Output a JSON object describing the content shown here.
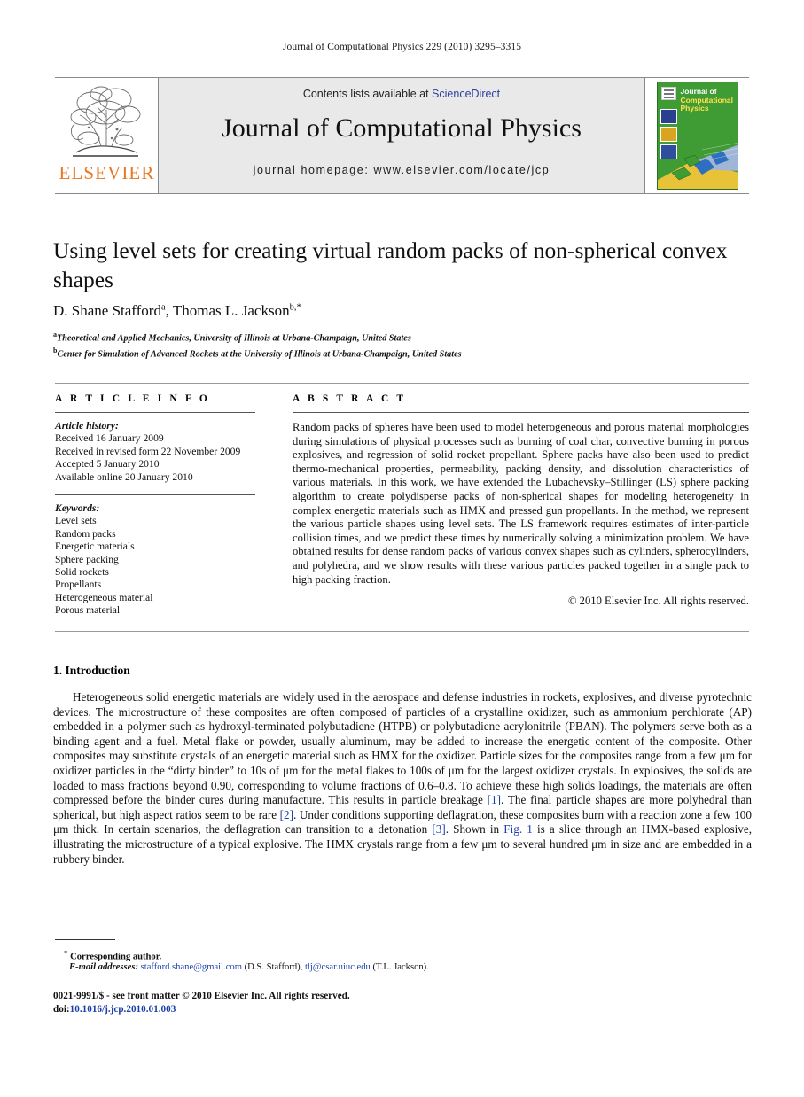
{
  "running_head": "Journal of Computational Physics 229 (2010) 3295–3315",
  "masthead": {
    "publisher_name": "ELSEVIER",
    "contents_prefix": "Contents lists available at",
    "sciencedirect_link": "ScienceDirect",
    "journal_name": "Journal of Computational Physics",
    "homepage_line": "journal homepage: www.elsevier.com/locate/jcp",
    "cover_title_line1": "Journal of",
    "cover_title_line2": "Computational",
    "cover_title_line3": "Physics",
    "accent_green": "#3f9c35",
    "accent_orange": "#e87722",
    "link_blue": "#2b3f9e"
  },
  "article": {
    "title": "Using level sets for creating virtual random packs of non-spherical convex shapes",
    "authors": "D. Shane Stafford ᵃ, Thomas L. Jackson ᵇ,*",
    "author_1": "D. Shane Stafford",
    "author_1_sup": "a",
    "author_2": "Thomas L. Jackson",
    "author_2_sup": "b,*",
    "affiliation_a_sup": "a",
    "affiliation_a": "Theoretical and Applied Mechanics, University of Illinois at Urbana-Champaign, United States",
    "affiliation_b_sup": "b",
    "affiliation_b": "Center for Simulation of Advanced Rockets at the University of Illinois at Urbana-Champaign, United States"
  },
  "article_info": {
    "heading": "A R T I C L E   I N F O",
    "history_label": "Article history:",
    "history": [
      "Received 16 January 2009",
      "Received in revised form 22 November 2009",
      "Accepted 5 January 2010",
      "Available online 20 January 2010"
    ],
    "keywords_label": "Keywords:",
    "keywords": [
      "Level sets",
      "Random packs",
      "Energetic materials",
      "Sphere packing",
      "Solid rockets",
      "Propellants",
      "Heterogeneous material",
      "Porous material"
    ]
  },
  "abstract": {
    "heading": "A B S T R A C T",
    "body": "Random packs of spheres have been used to model heterogeneous and porous material morphologies during simulations of physical processes such as burning of coal char, convective burning in porous explosives, and regression of solid rocket propellant. Sphere packs have also been used to predict thermo-mechanical properties, permeability, packing density, and dissolution characteristics of various materials. In this work, we have extended the Lubachevsky–Stillinger (LS) sphere packing algorithm to create polydisperse packs of non-spherical shapes for modeling heterogeneity in complex energetic materials such as HMX and pressed gun propellants. In the method, we represent the various particle shapes using level sets. The LS framework requires estimates of inter-particle collision times, and we predict these times by numerically solving a minimization problem. We have obtained results for dense random packs of various convex shapes such as cylinders, spherocylinders, and polyhedra, and we show results with these various particles packed together in a single pack to high packing fraction.",
    "copyright": "© 2010 Elsevier Inc. All rights reserved."
  },
  "section_1": {
    "heading": "1. Introduction",
    "paragraph_part_1": "Heterogeneous solid energetic materials are widely used in the aerospace and defense industries in rockets, explosives, and diverse pyrotechnic devices. The microstructure of these composites are often composed of particles of a crystalline oxidizer, such as ammonium perchlorate (AP) embedded in a polymer such as hydroxyl-terminated polybutadiene (HTPB) or polybutadiene acrylonitrile (PBAN). The polymers serve both as a binding agent and a fuel. Metal flake or powder, usually aluminum, may be added to increase the energetic content of the composite. Other composites may substitute crystals of an energetic material such as HMX for the oxidizer. Particle sizes for the composites range from a few μm for oxidizer particles in the “dirty binder” to 10s of μm for the metal flakes to 100s of μm for the largest oxidizer crystals. In explosives, the solids are loaded to mass fractions beyond 0.90, corresponding to volume fractions of 0.6–0.8. To achieve these high solids loadings, the materials are often compressed before the binder cures during manufacture. This results in particle breakage ",
    "ref_1": "[1]",
    "paragraph_part_2": ". The final particle shapes are more polyhedral than spherical, but high aspect ratios seem to be rare ",
    "ref_2": "[2]",
    "paragraph_part_3": ". Under conditions supporting deflagration, these composites burn with a reaction zone a few 100 μm thick. In certain scenarios, the deflagration can transition to a detonation ",
    "ref_3": "[3]",
    "paragraph_part_4": ". Shown in ",
    "fig_ref": "Fig. 1",
    "paragraph_part_5": " is a slice through an HMX-based explosive, illustrating the microstructure of a typical explosive. The HMX crystals range from a few μm to several hundred μm in size and are embedded in a rubbery binder."
  },
  "footnotes": {
    "corresponding_marker": "*",
    "corresponding_text": "Corresponding author.",
    "email_label": "E-mail addresses:",
    "email_1": "stafford.shane@gmail.com",
    "email_1_owner": "(D.S. Stafford)",
    "email_2": "tlj@csar.uiuc.edu",
    "email_2_owner": "(T.L. Jackson)",
    "issn_line": "0021-9991/$ - see front matter © 2010 Elsevier Inc. All rights reserved.",
    "doi_label": "doi:",
    "doi_value": "10.1016/j.jcp.2010.01.003"
  }
}
